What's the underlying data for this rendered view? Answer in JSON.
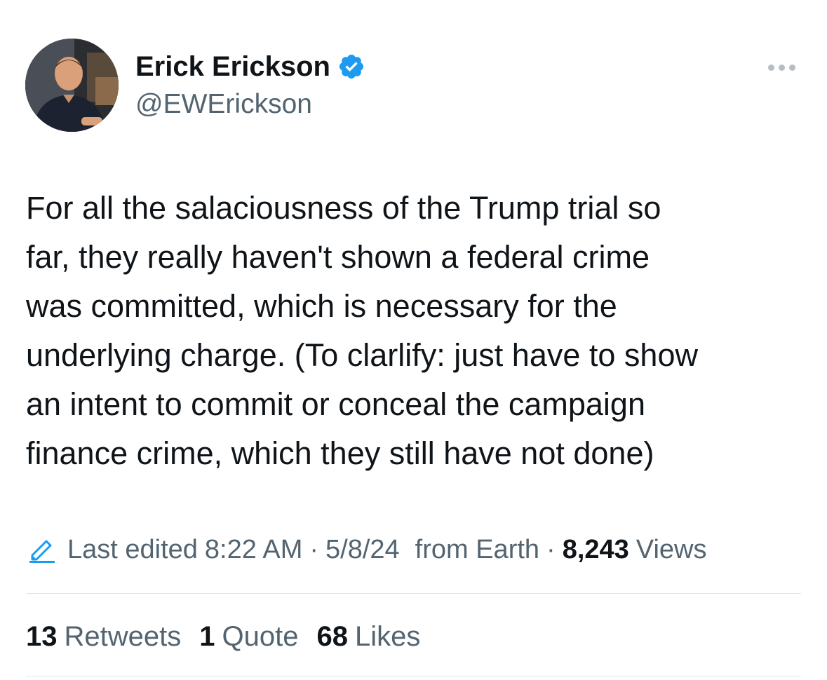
{
  "author": {
    "name": "Erick Erickson",
    "handle": "@EWErickson",
    "verified_color": "#1d9bf0"
  },
  "tweet": {
    "text_lines": [
      "For all the salaciousness of the Trump trial so",
      "far, they really haven't shown a federal crime",
      "was committed, which is necessary for the",
      "underlying charge. (To clarlify: just have to show",
      "an intent to commit or conceal the campaign",
      "finance crime, which they still have not done)"
    ]
  },
  "meta": {
    "edited_label": "Last edited",
    "time": "8:22 AM",
    "separator": "·",
    "date": "5/8/24",
    "location": "from Earth",
    "views_count": "8,243",
    "views_label": "Views"
  },
  "stats": {
    "retweets_count": "13",
    "retweets_label": "Retweets",
    "quotes_count": "1",
    "quotes_label": "Quote",
    "likes_count": "68",
    "likes_label": "Likes"
  },
  "icons": {
    "more": "more-horizontal-icon",
    "verified": "verified-badge-icon",
    "edit": "pencil-icon"
  },
  "colors": {
    "text": "#0f1419",
    "secondary": "#536471",
    "accent": "#1d9bf0",
    "divider": "#e1e5e8"
  }
}
